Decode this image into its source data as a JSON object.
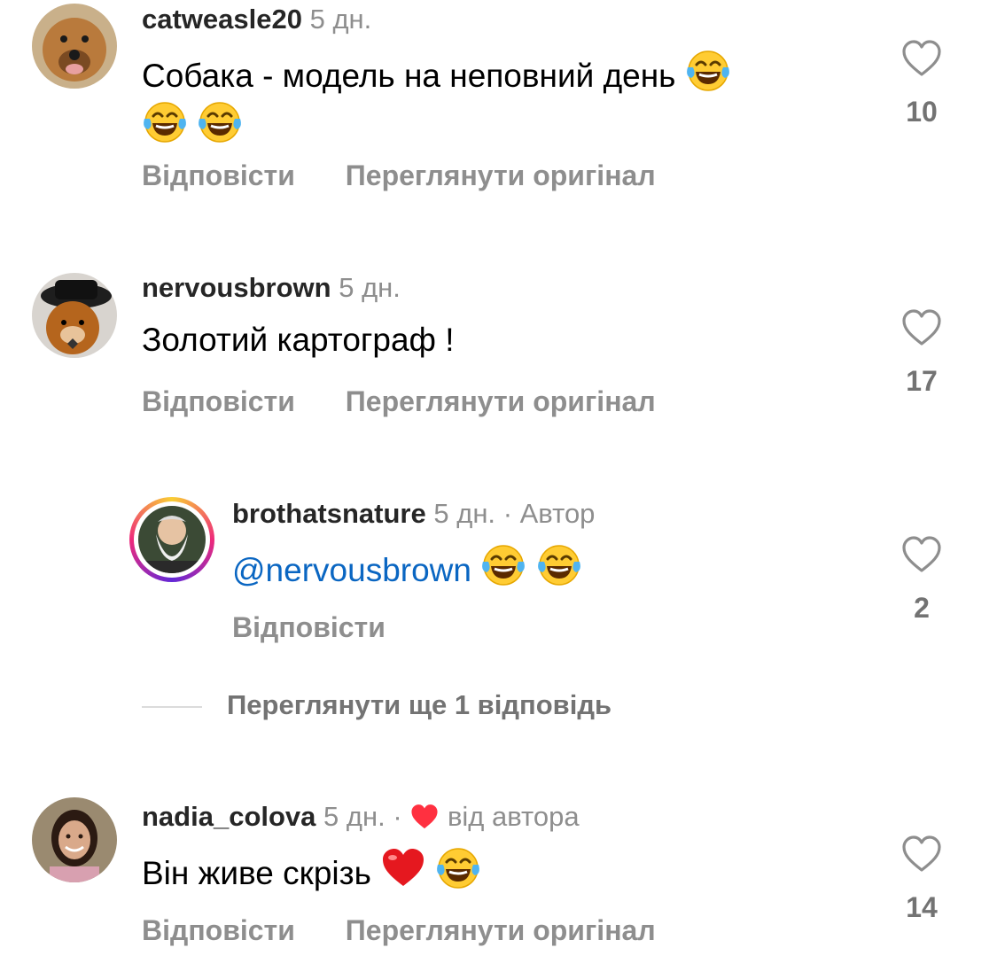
{
  "comments": [
    {
      "username": "catweasle20",
      "time": "5 дн.",
      "text": "Собака - модель на неповний день",
      "likes": "10",
      "reply_label": "Відповісти",
      "translate_label": "Переглянути оригінал"
    },
    {
      "username": "nervousbrown",
      "time": "5 дн.",
      "text": "Золотий картограф !",
      "likes": "17",
      "reply_label": "Відповісти",
      "translate_label": "Переглянути оригінал"
    },
    {
      "username": "brothatsnature",
      "time": "5 дн.",
      "author_badge": "· Автор",
      "mention": "@nervousbrown",
      "likes": "2",
      "reply_label": "Відповісти"
    },
    {
      "username": "nadia_colova",
      "time": "5 дн.",
      "liked_by_author": "від автора",
      "text": "Він живе скрізь",
      "likes": "14",
      "reply_label": "Відповісти",
      "translate_label": "Переглянути оригінал"
    }
  ],
  "view_more_replies": "Переглянути ще 1 відповідь",
  "icons": {
    "like": "heart-outline-icon",
    "author_heart": "heart-filled-icon",
    "laugh": "face-with-tears-of-joy-emoji",
    "red_heart": "red-heart-emoji"
  },
  "colors": {
    "username": "#262626",
    "meta": "#8e8e8e",
    "mention": "#0a66c2",
    "author_heart": "#ff3040"
  }
}
